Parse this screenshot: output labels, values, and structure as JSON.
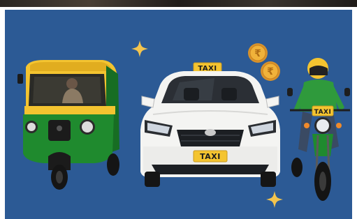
{
  "scene": {
    "background_color": "#2c5a95",
    "car_roof_sign": "TAXI",
    "car_plate": "TAXI",
    "bike_plate": "TAXI",
    "coin_symbol": "₹",
    "colors": {
      "taxi_yellow": "#f4c430",
      "auto_green": "#1f8a2e",
      "car_white": "#f4f4f2",
      "coin_gold": "#f0b23a",
      "sparkle": "#f3c44e"
    }
  }
}
